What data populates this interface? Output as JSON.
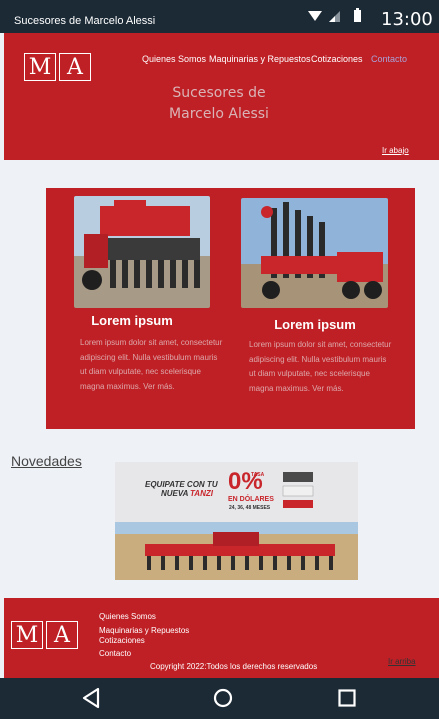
{
  "status_bar": {
    "app_title": "Sucesores de Marcelo Alessi",
    "time": "13:00"
  },
  "header": {
    "logo": [
      "M",
      "A"
    ],
    "nav": [
      "Quienes Somos",
      "Maquinarias y Repuestos",
      "Cotizaciones",
      "Contacto"
    ],
    "active_nav": "Contacto",
    "title_line1": "Sucesores de",
    "title_line2": "Marcelo Alessi",
    "scroll_down": "Ir abajo"
  },
  "products": [
    {
      "title": "Lorem ipsum",
      "body": "Lorem ipsum dolor sit amet, consectetur adipiscing elit. Nulla vestibulum mauris ut diam vulputate, nec scelerisque magna maximus.  Ver más."
    },
    {
      "title": "Lorem ipsum",
      "body": "Lorem ipsum dolor sit amet, consectetur adipiscing elit. Nulla vestibulum mauris ut diam vulputate, nec scelerisque magna maximus.  Ver más."
    }
  ],
  "news": {
    "heading": "Novedades",
    "banner": {
      "line1": "EQUIPATE CON TU",
      "line2a": "NUEVA",
      "line2b": "TANZI",
      "rate_small": "TASA",
      "rate": "0%",
      "currency": "EN DÓLARES",
      "terms": "24, 36, 48 MESES"
    }
  },
  "footer": {
    "logo": [
      "M",
      "A"
    ],
    "links": [
      "Quienes Somos",
      "Maquinarias y Repuestos",
      "Cotizaciones",
      "Contacto"
    ],
    "copyright": "Copyright 2022:Todos los derechos reservados",
    "scroll_up": "Ir arriba"
  },
  "colors": {
    "brand_red": "#bf2026",
    "system_bar": "#1c2a36",
    "page_bg": "#eef1f6",
    "active_link": "#a8a2d8"
  }
}
